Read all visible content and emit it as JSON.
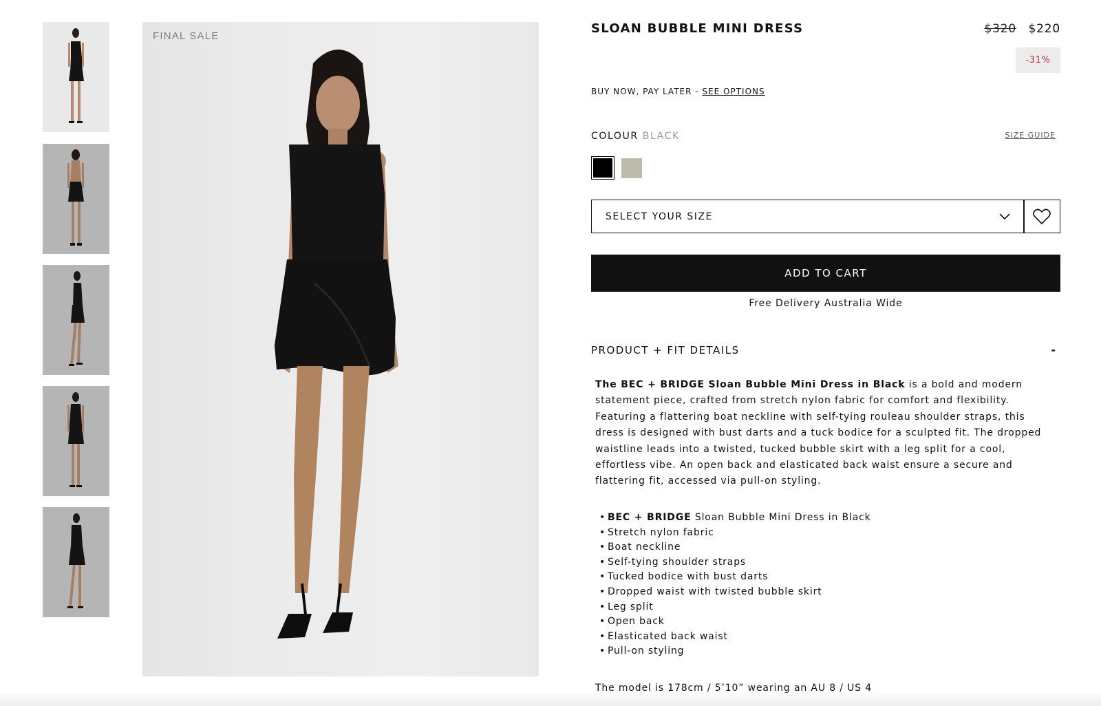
{
  "gallery": {
    "badge": "FINAL SALE",
    "thumbnails": [
      {
        "view": "front",
        "background": "#e8e8e8"
      },
      {
        "view": "back",
        "background": "#b9b9b9"
      },
      {
        "view": "side",
        "background": "#b9b9b9"
      },
      {
        "view": "front-posed",
        "background": "#b9b9b9"
      },
      {
        "view": "three-quarter",
        "background": "#b9b9b9"
      }
    ]
  },
  "product": {
    "title": "SLOAN BUBBLE MINI DRESS",
    "price_original": "$320",
    "price_sale": "$220",
    "discount": "-31%",
    "bnpl_text": "BUY NOW, PAY LATER - ",
    "bnpl_link": "SEE OPTIONS",
    "colour_label": "COLOUR",
    "colour_value": "BLACK",
    "size_guide": "SIZE GUIDE",
    "swatches": [
      {
        "name": "Black",
        "color": "#000000",
        "selected": true
      },
      {
        "name": "Taupe",
        "color": "#bdbbac",
        "selected": false
      }
    ],
    "size_placeholder": "SELECT YOUR SIZE",
    "add_to_cart": "ADD TO CART",
    "free_delivery": "Free Delivery Australia Wide"
  },
  "details": {
    "header": "PRODUCT + FIT DETAILS",
    "toggle": "-",
    "intro_bold": "The BEC + BRIDGE Sloan Bubble Mini Dress in Black",
    "intro_rest": " is a bold and modern statement piece, crafted from stretch nylon fabric for comfort and flexibility. Featuring a flattering boat neckline with self-tying rouleau shoulder straps, this dress is designed with bust darts and a tuck bodice for a sculpted fit. The dropped waistline leads into a twisted, tucked bubble skirt with a leg split for a cool, effortless vibe. An open back and elasticated back waist ensure a secure and flattering fit, accessed via pull-on styling.",
    "first_feature_bold": "BEC + BRIDGE",
    "first_feature_rest": " Sloan Bubble Mini Dress in Black",
    "features": [
      "Stretch nylon fabric",
      "Boat neckline",
      "Self-tying shoulder straps",
      "Tucked bodice with bust darts",
      "Dropped waist with twisted bubble skirt",
      "Leg split",
      "Open back",
      "Elasticated back waist",
      "Pull-on styling"
    ],
    "model_info": "The model is 178cm / 5’10” wearing an AU 8 / US 4"
  },
  "icons": {
    "chevron": "chevron-down-icon",
    "wishlist": "heart-icon"
  }
}
